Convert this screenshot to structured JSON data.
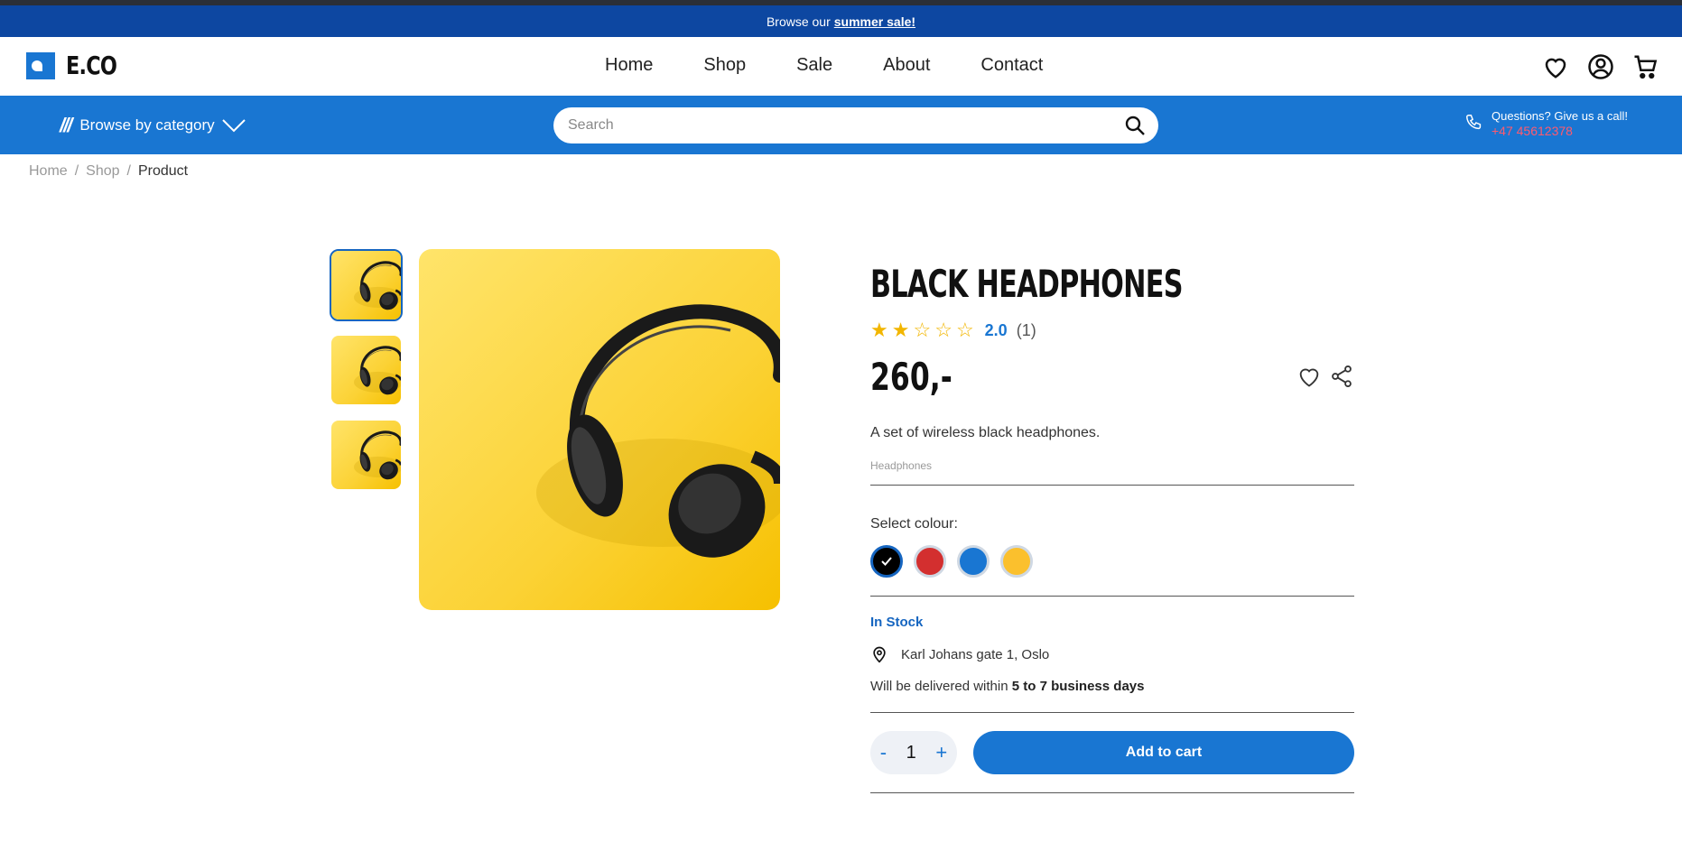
{
  "promo": {
    "text": "Browse our",
    "link": "summer sale!"
  },
  "brand": {
    "name": "E.CO"
  },
  "nav": {
    "items": [
      "Home",
      "Shop",
      "Sale",
      "About",
      "Contact"
    ]
  },
  "header_icons": [
    "heart-icon",
    "account-icon",
    "cart-icon"
  ],
  "category_bar": {
    "browse_label": "Browse by category",
    "search_placeholder": "Search",
    "help_question": "Questions? Give us a call!",
    "help_phone": "+47 45612378"
  },
  "breadcrumb": {
    "items": [
      "Home",
      "Shop",
      "Product"
    ]
  },
  "product": {
    "title": "BLACK HEADPHONES",
    "rating_value": "2.0",
    "rating_count": "(1)",
    "rating_stars": 2,
    "rating_max": 5,
    "price": "260,-",
    "description": "A set of wireless black headphones.",
    "category_tag": "Headphones",
    "select_colour_label": "Select colour:",
    "colours": [
      "#000000",
      "#d32f2f",
      "#1976d2",
      "#fbc02d"
    ],
    "selected_colour_index": 0,
    "stock_status": "In Stock",
    "location": "Karl Johans gate 1, Oslo",
    "delivery_prefix": "Will be delivered within",
    "delivery_time": "5 to 7 business days",
    "quantity": "1",
    "qty_minus": "-",
    "qty_plus": "+",
    "add_to_cart_label": "Add to cart"
  },
  "colors": {
    "primary": "#1976d2",
    "promo_bg": "#0d47a1",
    "phone": "#ff5a6e",
    "star": "#f2b600"
  }
}
